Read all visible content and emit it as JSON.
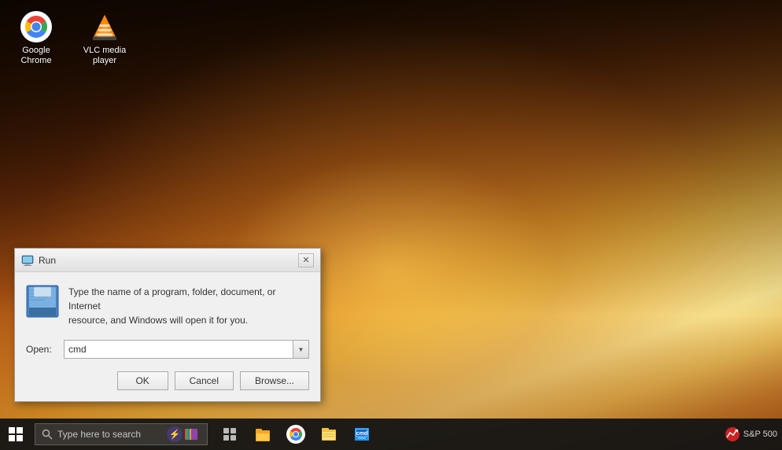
{
  "desktop": {
    "icons": [
      {
        "id": "google-chrome",
        "label": "Google Chrome",
        "type": "chrome"
      },
      {
        "id": "vlc-media-player",
        "label": "VLC media player",
        "type": "vlc"
      }
    ]
  },
  "run_dialog": {
    "title": "Run",
    "description_line1": "Type the name of a program, folder, document, or Internet",
    "description_line2": "resource, and Windows will open it for you.",
    "open_label": "Open:",
    "input_value": "cmd",
    "ok_label": "OK",
    "cancel_label": "Cancel",
    "browse_label": "Browse..."
  },
  "taskbar": {
    "search_placeholder": "Type here to search",
    "stock_label": "S&P 500",
    "stock_icon": "📈"
  }
}
